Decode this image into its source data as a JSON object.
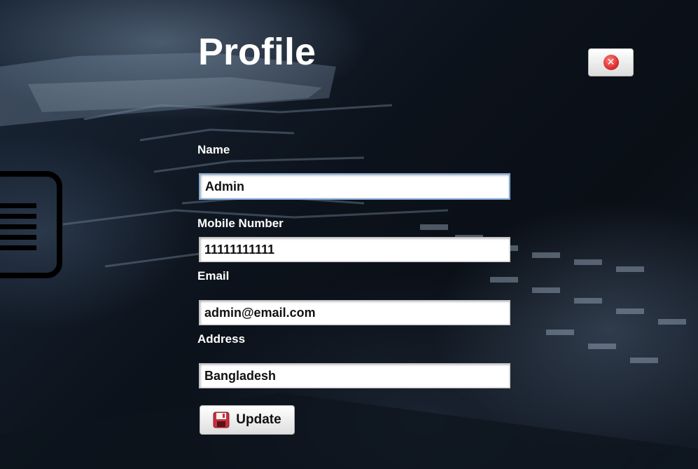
{
  "page": {
    "title": "Profile"
  },
  "close_button": {
    "icon": "close-icon",
    "glyph": "✕",
    "color": "#d92b2b"
  },
  "form": {
    "name": {
      "label": "Name",
      "value": "Admin"
    },
    "mobile": {
      "label": "Mobile Number",
      "value": "11111111111"
    },
    "email": {
      "label": "Email",
      "value": "admin@email.com"
    },
    "address": {
      "label": "Address",
      "value": "Bangladesh"
    }
  },
  "update_button": {
    "label": "Update",
    "icon": "save-icon"
  },
  "colors": {
    "focus_border": "#7ea7d6",
    "text": "#ffffff"
  }
}
